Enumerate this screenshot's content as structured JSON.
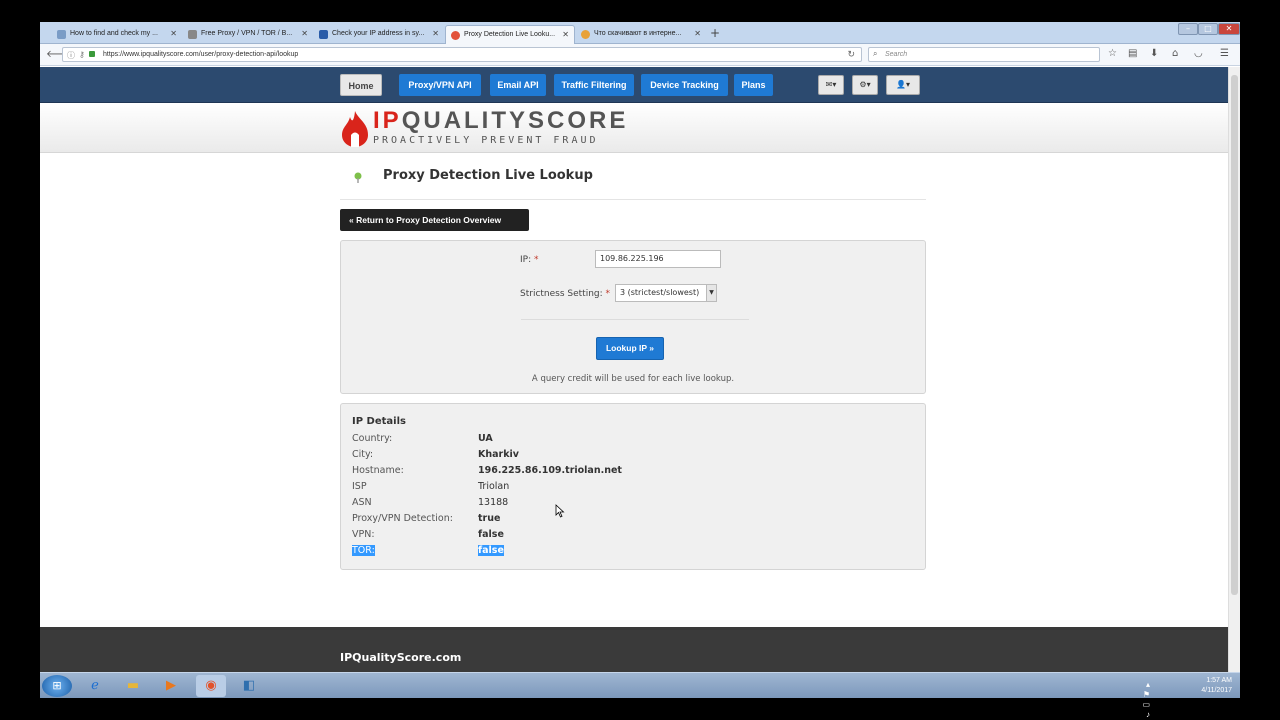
{
  "browser": {
    "tabs": [
      {
        "label": "How to find and check my ...",
        "fav_color": "#7a9cc6"
      },
      {
        "label": "Free Proxy / VPN / TOR / B...",
        "fav_color": "#888888"
      },
      {
        "label": "Check your IP address in sy...",
        "fav_color": "#2a5ca8"
      },
      {
        "label": "Proxy Detection Live Looku...",
        "fav_color": "#e2523b"
      },
      {
        "label": "Что скачивают в интерне...",
        "fav_color": "#e8a23a"
      }
    ],
    "new_tab": "+",
    "url": "https://www.ipqualityscore.com/user/proxy-detection-api/lookup",
    "search_placeholder": "Search"
  },
  "site_nav": {
    "items": [
      "Home",
      "Proxy/VPN API",
      "Email API",
      "Traffic Filtering",
      "Device Tracking",
      "Plans"
    ]
  },
  "logo": {
    "ip": "IP",
    "rest": "QUALITYSCORE",
    "tagline": "PROACTIVELY PREVENT FRAUD"
  },
  "page": {
    "title": "Proxy Detection Live Lookup",
    "return_label": "« Return to Proxy Detection Overview"
  },
  "form": {
    "ip_label": "IP:",
    "ip_value": "109.86.225.196",
    "strictness_label": "Strictness Setting:",
    "strictness_value": "3 (strictest/slowest)",
    "required_mark": "*",
    "lookup_label": "Lookup IP »",
    "credit_note": "A query credit will be used for each live lookup."
  },
  "details": {
    "title": "IP Details",
    "rows": [
      {
        "key": "Country:",
        "value": "UA"
      },
      {
        "key": "City:",
        "value": "Kharkiv"
      },
      {
        "key": "Hostname:",
        "value": "196.225.86.109.triolan.net"
      },
      {
        "key": "ISP",
        "value": "Triolan"
      },
      {
        "key": "ASN",
        "value": "13188"
      },
      {
        "key": "Proxy/VPN Detection:",
        "value": "true"
      },
      {
        "key": "VPN:",
        "value": "false"
      },
      {
        "key": "TOR:",
        "value": "false"
      }
    ]
  },
  "footer": {
    "text": "IPQualityScore.com"
  },
  "taskbar": {
    "time": "1:57 AM",
    "date": "4/11/2017"
  },
  "colors": {
    "nav_bg": "#2c4a6f",
    "accent": "#1f7ad4",
    "brand_red": "#d9241b"
  }
}
